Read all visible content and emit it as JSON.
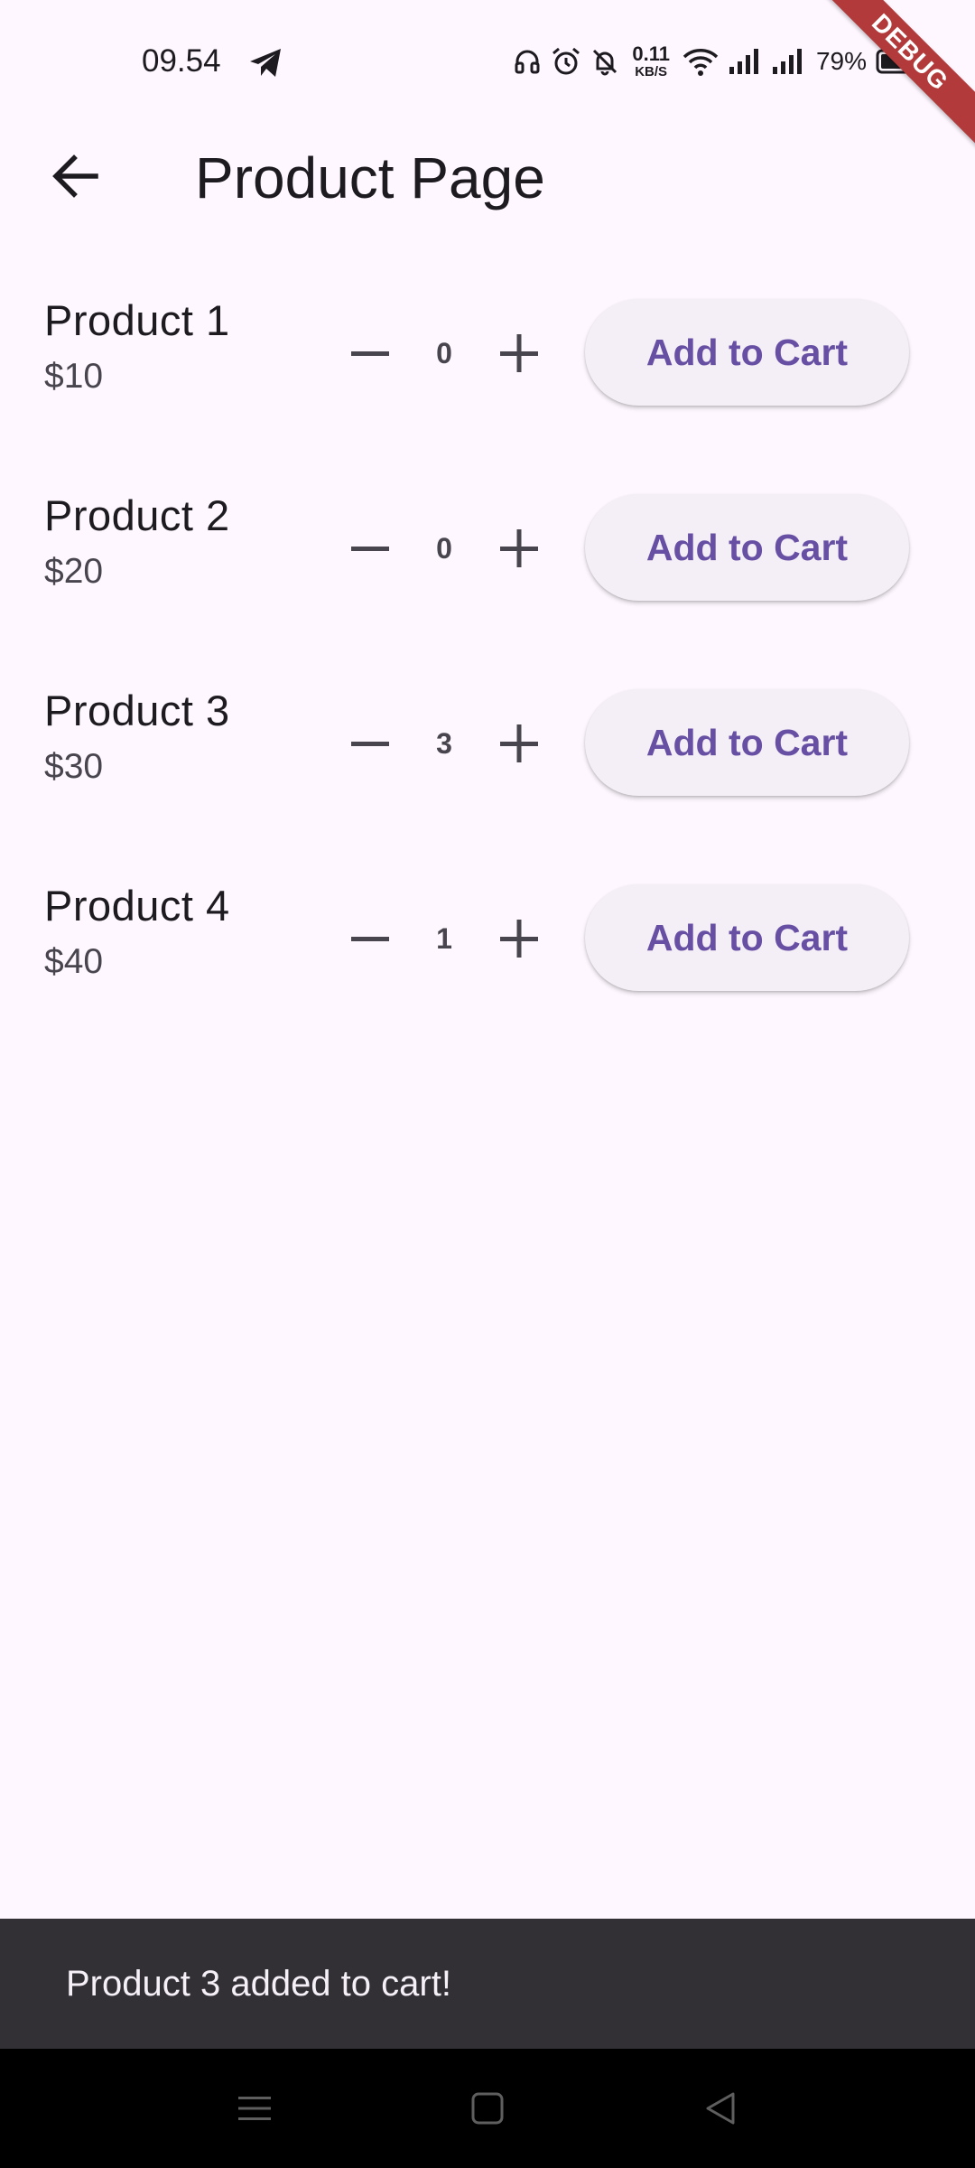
{
  "status_bar": {
    "time": "09.54",
    "net_speed_value": "0.11",
    "net_speed_unit": "KB/S",
    "battery": "79%",
    "debug_label": "DEBUG",
    "icons": [
      "telegram-icon",
      "headphones-icon",
      "alarm-icon",
      "bell-off-icon",
      "wifi-icon",
      "signal-icon",
      "signal-icon",
      "battery-icon"
    ]
  },
  "app_bar": {
    "title": "Product Page",
    "back_icon": "arrow-left-icon"
  },
  "products": [
    {
      "name": "Product 1",
      "price": "$10",
      "quantity": "0",
      "button_label": "Add to Cart"
    },
    {
      "name": "Product 2",
      "price": "$20",
      "quantity": "0",
      "button_label": "Add to Cart"
    },
    {
      "name": "Product 3",
      "price": "$30",
      "quantity": "3",
      "button_label": "Add to Cart"
    },
    {
      "name": "Product 4",
      "price": "$40",
      "quantity": "1",
      "button_label": "Add to Cart"
    }
  ],
  "snackbar": {
    "message": "Product 3 added to cart!"
  },
  "nav_bar": {
    "icons": [
      "menu-icon",
      "home-icon",
      "back-triangle-icon"
    ]
  },
  "colors": {
    "background": "#FEF7FF",
    "accent": "#6750A4",
    "button_bg": "#F4EEF6",
    "snackbar_bg": "#322F35",
    "debug_banner": "#B33A3A"
  }
}
